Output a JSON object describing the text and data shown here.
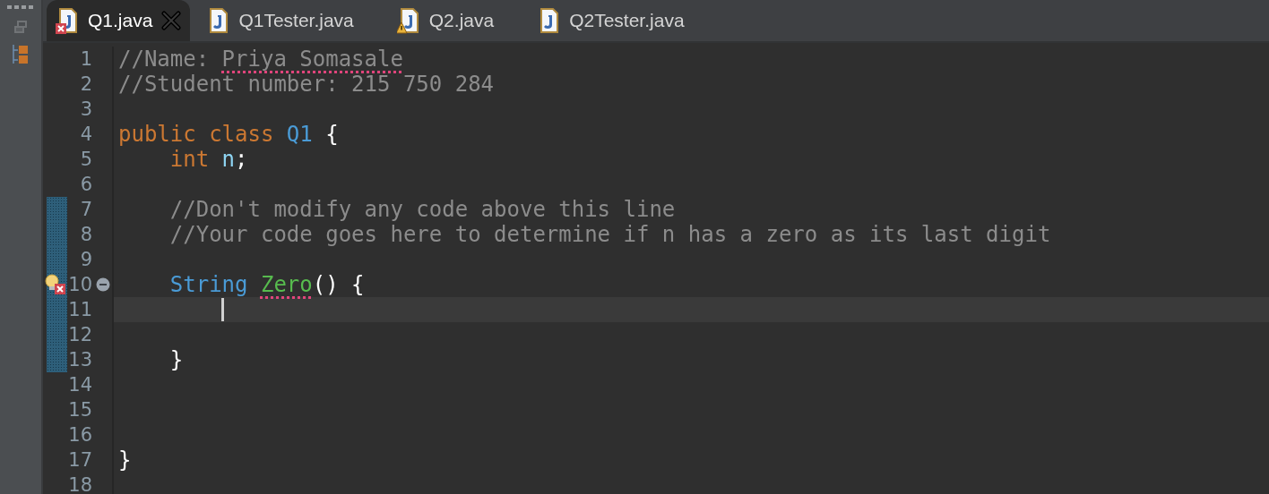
{
  "tabs": [
    {
      "label": "Q1.java",
      "selected": true,
      "error": true,
      "warning": false
    },
    {
      "label": "Q1Tester.java",
      "selected": false,
      "error": false,
      "warning": false
    },
    {
      "label": "Q2.java",
      "selected": false,
      "error": false,
      "warning": true
    },
    {
      "label": "Q2Tester.java",
      "selected": false,
      "error": false,
      "warning": false
    }
  ],
  "lines": [
    {
      "number": "1",
      "changed": false,
      "tokens": [
        {
          "text": "//Name: ",
          "kind": "comment",
          "misspelled": false
        },
        {
          "text": "Priya Somasale",
          "kind": "comment",
          "misspelled": true
        }
      ]
    },
    {
      "number": "2",
      "changed": false,
      "tokens": [
        {
          "text": "//Student number: 215 750 284",
          "kind": "comment",
          "misspelled": false
        }
      ]
    },
    {
      "number": "3",
      "changed": false
    },
    {
      "number": "4",
      "changed": false,
      "tokens": [
        {
          "text": "public class ",
          "kind": "keyword",
          "misspelled": false
        },
        {
          "text": "Q1",
          "kind": "type",
          "misspelled": false
        },
        {
          "text": " {",
          "kind": "plain",
          "misspelled": false
        }
      ]
    },
    {
      "number": "5",
      "changed": false,
      "tokens": [
        {
          "text": "    int ",
          "kind": "keyword",
          "misspelled": false
        },
        {
          "text": "n",
          "kind": "field",
          "misspelled": false
        },
        {
          "text": ";",
          "kind": "plain",
          "misspelled": false
        }
      ]
    },
    {
      "number": "6",
      "changed": false
    },
    {
      "number": "7",
      "changed": true,
      "tokens": [
        {
          "text": "    //Don't modify any code above this line",
          "kind": "comment",
          "misspelled": false
        }
      ]
    },
    {
      "number": "8",
      "changed": true,
      "tokens": [
        {
          "text": "    //Your code goes here to determine if n has a zero as its last digit",
          "kind": "comment",
          "misspelled": false
        }
      ]
    },
    {
      "number": "9",
      "changed": true
    },
    {
      "number": "10",
      "changed": true,
      "error": true,
      "expanded": true,
      "tokens": [
        {
          "text": "    String ",
          "kind": "type",
          "misspelled": false
        },
        {
          "text": "Zero",
          "kind": "method",
          "misspelled": true
        },
        {
          "text": "() {",
          "kind": "plain",
          "misspelled": false
        }
      ]
    },
    {
      "number": "11",
      "current": true,
      "changed": true,
      "cursor": true
    },
    {
      "number": "12",
      "changed": true
    },
    {
      "number": "13",
      "changed": true,
      "tokens": [
        {
          "text": "    }",
          "kind": "plain",
          "misspelled": false
        }
      ]
    },
    {
      "number": "14",
      "changed": false
    },
    {
      "number": "15",
      "changed": false
    },
    {
      "number": "16",
      "changed": false
    },
    {
      "number": "17",
      "changed": false,
      "tokens": [
        {
          "text": "}",
          "kind": "plain",
          "misspelled": false
        }
      ]
    },
    {
      "number": "18",
      "changed": false
    }
  ]
}
